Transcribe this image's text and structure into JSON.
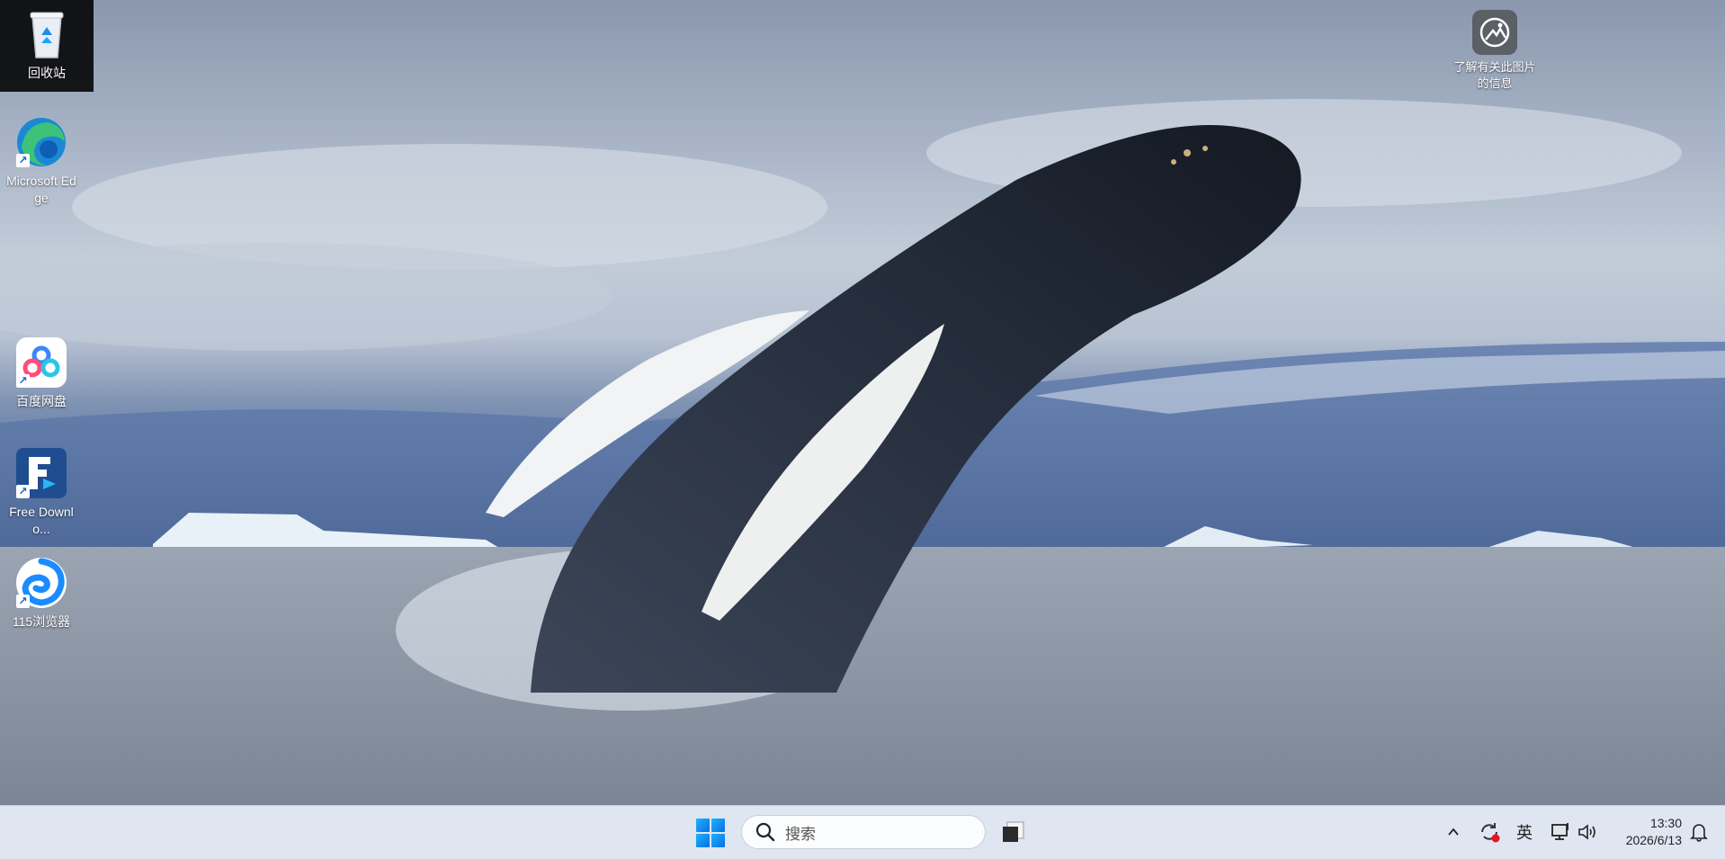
{
  "desktop": {
    "icons": [
      {
        "label": "回收站",
        "name": "recycle-bin"
      },
      {
        "label": "Microsoft Edge",
        "name": "microsoft-edge"
      },
      {
        "label": "百度网盘",
        "name": "baidu-netdisk"
      },
      {
        "label": "Free Downlo...",
        "name": "free-download-manager"
      },
      {
        "label": "115浏览器",
        "name": "115-browser"
      }
    ],
    "info_icon_label": "了解有关此图片的信息"
  },
  "taskbar": {
    "search_placeholder": "搜索",
    "ime_label": "英",
    "time": "13:30",
    "date": "2026/6/13"
  },
  "colors": {
    "taskbar_bg": "#dfe6f1",
    "start_accent": "#0a6fe0",
    "notification_dot": "#e81123"
  }
}
